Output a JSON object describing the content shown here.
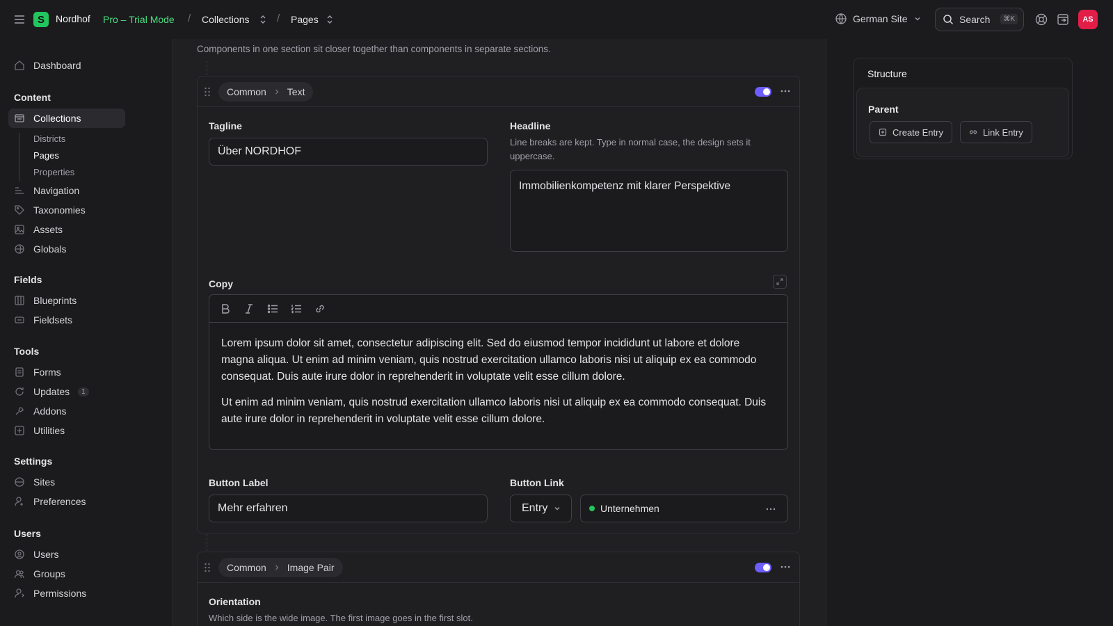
{
  "topbar": {
    "site_name": "Nordhof",
    "logo_letter": "S",
    "trial_label": "Pro – Trial Mode",
    "breadcrumb": [
      "Collections",
      "Pages"
    ],
    "site_selector": "German Site",
    "search_label": "Search",
    "search_shortcut": "⌘K",
    "avatar_initials": "AS"
  },
  "sidebar": {
    "dashboard": "Dashboard",
    "sections": {
      "content": "Content",
      "fields": "Fields",
      "tools": "Tools",
      "settings": "Settings",
      "users": "Users"
    },
    "content_items": [
      "Collections",
      "Navigation",
      "Taxonomies",
      "Assets",
      "Globals"
    ],
    "collection_children": [
      "Districts",
      "Pages",
      "Properties"
    ],
    "field_items": [
      "Blueprints",
      "Fieldsets"
    ],
    "tool_items": [
      "Forms",
      "Updates",
      "Addons",
      "Utilities"
    ],
    "updates_badge": "1",
    "setting_items": [
      "Sites",
      "Preferences"
    ],
    "user_items": [
      "Users",
      "Groups",
      "Permissions"
    ]
  },
  "main": {
    "section_note": "Components in one section sit closer together than components in separate sections.",
    "text_block": {
      "set_group": "Common",
      "set_name": "Text",
      "enabled": true,
      "tagline_label": "Tagline",
      "tagline_value": "Über NORDHOF",
      "headline_label": "Headline",
      "headline_help": "Line breaks are kept. Type in normal case, the design sets it uppercase.",
      "headline_value": "Immobilienkompetenz mit klarer Perspektive",
      "copy_label": "Copy",
      "copy_paragraphs": [
        "Lorem ipsum dolor sit amet, consectetur adipiscing elit. Sed do eiusmod tempor incididunt ut labore et dolore magna aliqua. Ut enim ad minim veniam, quis nostrud exercitation ullamco laboris nisi ut aliquip ex ea commodo consequat. Duis aute irure dolor in reprehenderit in voluptate velit esse cillum dolore.",
        "Ut enim ad minim veniam, quis nostrud exercitation ullamco laboris nisi ut aliquip ex ea commodo consequat. Duis aute irure dolor in reprehenderit in voluptate velit esse cillum dolore."
      ],
      "button_label_label": "Button Label",
      "button_label_value": "Mehr erfahren",
      "button_link_label": "Button Link",
      "button_link_type": "Entry",
      "button_link_entry": "Unternehmen"
    },
    "image_block": {
      "set_group": "Common",
      "set_name": "Image Pair",
      "enabled": true,
      "orientation_label": "Orientation",
      "orientation_help": "Which side is the wide image. The first image goes in the first slot."
    }
  },
  "right_panel": {
    "title": "Structure",
    "parent_label": "Parent",
    "create_entry": "Create Entry",
    "link_entry": "Link Entry"
  },
  "colors": {
    "accent": "#6d5efc",
    "brand": "#22c55e",
    "status_published": "#22c55e",
    "avatar": "#e11d48"
  }
}
